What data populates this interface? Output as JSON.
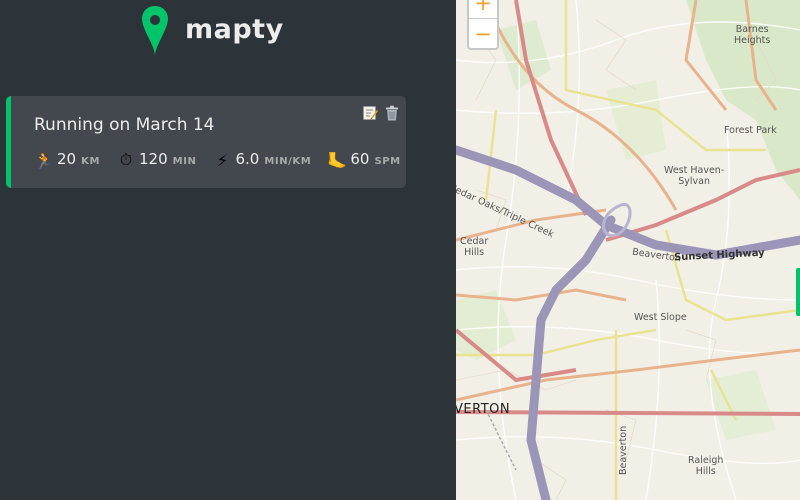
{
  "app": {
    "logo_text": "mapty",
    "brand_color": "#00c46a"
  },
  "workouts": [
    {
      "title": "Running on March 14",
      "type_color": "#00c46a",
      "actions": [
        {
          "icon": "edit-icon"
        },
        {
          "icon": "trash-icon"
        }
      ],
      "details": [
        {
          "icon": "runner-icon",
          "emoji": "🏃",
          "value": "20",
          "unit": "KM"
        },
        {
          "icon": "stopwatch-icon",
          "emoji": "⏱",
          "value": "120",
          "unit": "MIN"
        },
        {
          "icon": "lightning-icon",
          "emoji": "⚡",
          "value": "6.0",
          "unit": "MIN/KM"
        },
        {
          "icon": "footprint-icon",
          "emoji": "🦶",
          "value": "60",
          "unit": "SPM"
        }
      ]
    }
  ],
  "map": {
    "zoom_in": "+",
    "zoom_out": "−",
    "labels": {
      "barnes_heights": "Barnes\nHeights",
      "forest_park": "Forest Park",
      "west_haven": "West Haven-\nSylvan",
      "cedar_oaks": "Cedar Oaks/Triple Creek",
      "cedar_hills": "Cedar\nHills",
      "beaverton_small": "Beaverton",
      "sunset_highway": "Sunset Highway",
      "west_slope": "West Slope",
      "beaverton_big": "VERTON",
      "raleigh_hills": "Raleigh\nHills",
      "beaverton_vertical": "Beaverton"
    }
  }
}
